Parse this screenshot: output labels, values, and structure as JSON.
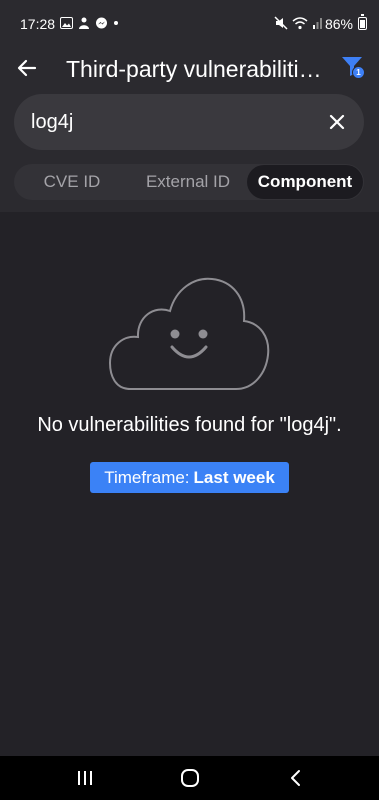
{
  "status_bar": {
    "time": "17:28",
    "battery": "86%"
  },
  "header": {
    "title": "Third-party vulnerabiliti…",
    "back_icon": "arrow-left-icon",
    "filter_icon": "filter-icon",
    "filter_count": "1"
  },
  "search": {
    "value": "log4j",
    "clear_icon": "close-icon"
  },
  "tabs": [
    {
      "label": "CVE ID",
      "active": false
    },
    {
      "label": "External ID",
      "active": false
    },
    {
      "label": "Component",
      "active": true
    }
  ],
  "empty_state": {
    "icon": "happy-cloud-icon",
    "message": "No vulnerabilities found for \"log4j\".",
    "timeframe_label": "Timeframe:",
    "timeframe_value": "Last week"
  },
  "nav_bar": {
    "recents_icon": "recents-icon",
    "home_icon": "home-icon",
    "back_icon": "back-chevron-icon"
  },
  "colors": {
    "background": "#232227",
    "header_background": "#2b2a2f",
    "accent": "#3b82f6"
  }
}
